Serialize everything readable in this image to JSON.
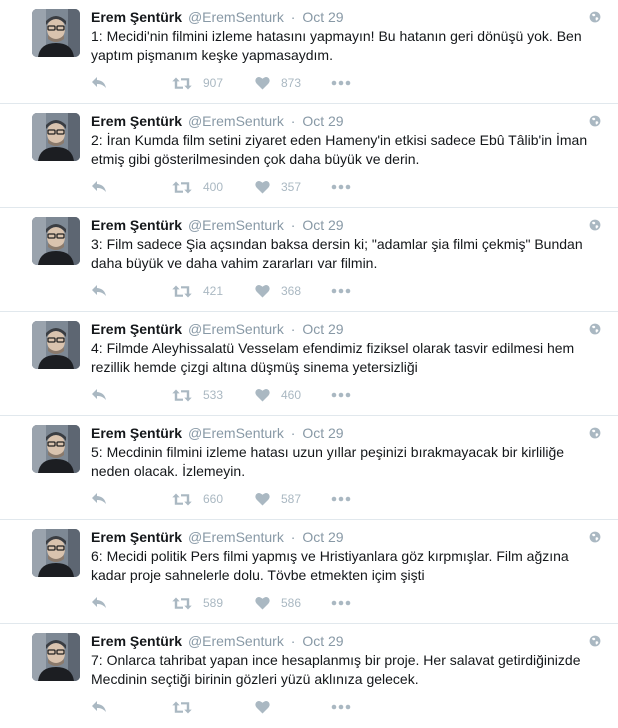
{
  "colors": {
    "name": "#14171a",
    "muted": "#8899a6",
    "icon": "#aab8c2",
    "divider": "#e1e8ed"
  },
  "tweets": [
    {
      "fullname": "Erem Şentürk",
      "username": "@EremSenturk",
      "sep": "·",
      "time": "Oct 29",
      "text": "1: Mecidi'nin filmini izleme hatasını yapmayın! Bu hatanın geri dönüşü yok. Ben yaptım pişmanım keşke yapmasaydım.",
      "retweets": "907",
      "likes": "873"
    },
    {
      "fullname": "Erem Şentürk",
      "username": "@EremSenturk",
      "sep": "·",
      "time": "Oct 29",
      "text": "2: İran Kumda film setini ziyaret eden Hameny'in etkisi sadece Ebû Tâlib'in İman etmiş gibi gösterilmesinden çok daha büyük ve derin.",
      "retweets": "400",
      "likes": "357"
    },
    {
      "fullname": "Erem Şentürk",
      "username": "@EremSenturk",
      "sep": "·",
      "time": "Oct 29",
      "text": "3: Film sadece Şia açsından baksa dersin ki; \"adamlar şia filmi çekmiş\" Bundan daha büyük ve daha vahim zararları var filmin.",
      "retweets": "421",
      "likes": "368"
    },
    {
      "fullname": "Erem Şentürk",
      "username": "@EremSenturk",
      "sep": "·",
      "time": "Oct 29",
      "text": "4: Filmde Aleyhissalatü Vesselam efendimiz fiziksel olarak tasvir edilmesi hem rezillik hemde çizgi altına düşmüş sinema yetersizliği",
      "retweets": "533",
      "likes": "460"
    },
    {
      "fullname": "Erem Şentürk",
      "username": "@EremSenturk",
      "sep": "·",
      "time": "Oct 29",
      "text": "5: Mecdinin filmini izleme hatası uzun yıllar peşinizi bırakmayacak bir kirliliğe neden olacak. İzlemeyin.",
      "retweets": "660",
      "likes": "587"
    },
    {
      "fullname": "Erem Şentürk",
      "username": "@EremSenturk",
      "sep": "·",
      "time": "Oct 29",
      "text": "6: Mecidi politik Pers filmi yapmış ve Hristiyanlara göz kırpmışlar. Film ağzına kadar proje sahnelerle dolu. Tövbe etmekten içim şişti",
      "retweets": "589",
      "likes": "586"
    },
    {
      "fullname": "Erem Şentürk",
      "username": "@EremSenturk",
      "sep": "·",
      "time": "Oct 29",
      "text": "7: Onlarca tahribat yapan ince hesaplanmış bir proje. Her salavat getirdiğinizde Mecdinin seçtiği birinin gözleri yüzü aklınıza gelecek.",
      "retweets": "",
      "likes": ""
    }
  ],
  "icons": {
    "avatar": "profile-photo",
    "globe": "globe-icon",
    "reply": "reply-icon",
    "retweet": "retweet-icon",
    "like": "heart-icon",
    "more": "more-icon"
  }
}
